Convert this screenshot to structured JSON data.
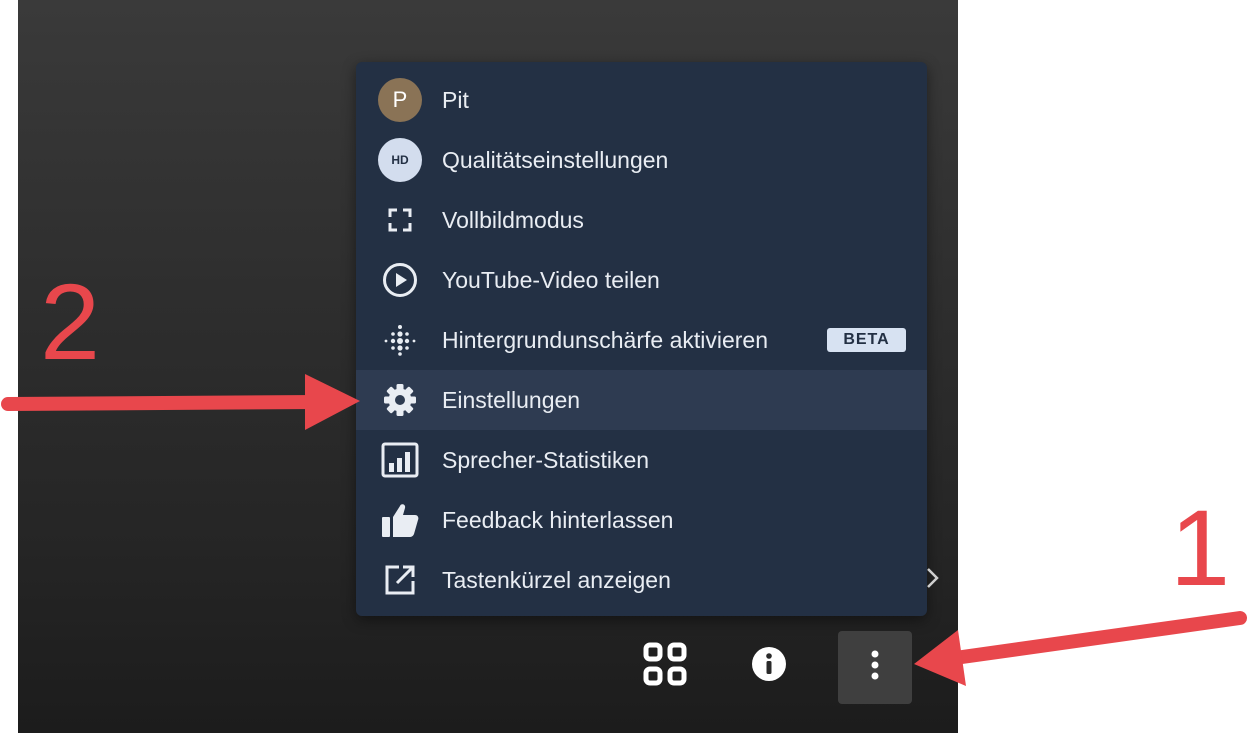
{
  "menu": {
    "items": [
      {
        "label": "Pit",
        "icon": "avatar",
        "avatar_initial": "P"
      },
      {
        "label": "Qualitätseinstellungen",
        "icon": "hd-icon",
        "badge_text": "HD"
      },
      {
        "label": "Vollbildmodus",
        "icon": "fullscreen-icon"
      },
      {
        "label": "YouTube-Video teilen",
        "icon": "play-circle-icon"
      },
      {
        "label": "Hintergrundunschärfe aktivieren",
        "icon": "blur-icon",
        "tag": "BETA"
      },
      {
        "label": "Einstellungen",
        "icon": "gear-icon",
        "highlighted": true
      },
      {
        "label": "Sprecher-Statistiken",
        "icon": "bar-chart-icon"
      },
      {
        "label": "Feedback hinterlassen",
        "icon": "thumbs-up-icon"
      },
      {
        "label": "Tastenkürzel anzeigen",
        "icon": "external-link-icon"
      }
    ]
  },
  "toolbar": {
    "buttons": [
      {
        "name": "tile-view-button",
        "icon": "grid-icon"
      },
      {
        "name": "info-button",
        "icon": "info-icon"
      },
      {
        "name": "more-options-button",
        "icon": "more-vertical-icon",
        "active": true
      }
    ]
  },
  "annotations": {
    "callout_1": "1",
    "callout_2": "2",
    "color": "#e8474c"
  },
  "colors": {
    "menu_bg": "#233044",
    "menu_highlight": "#2e3b51",
    "video_bg": "#2e2e2e"
  }
}
